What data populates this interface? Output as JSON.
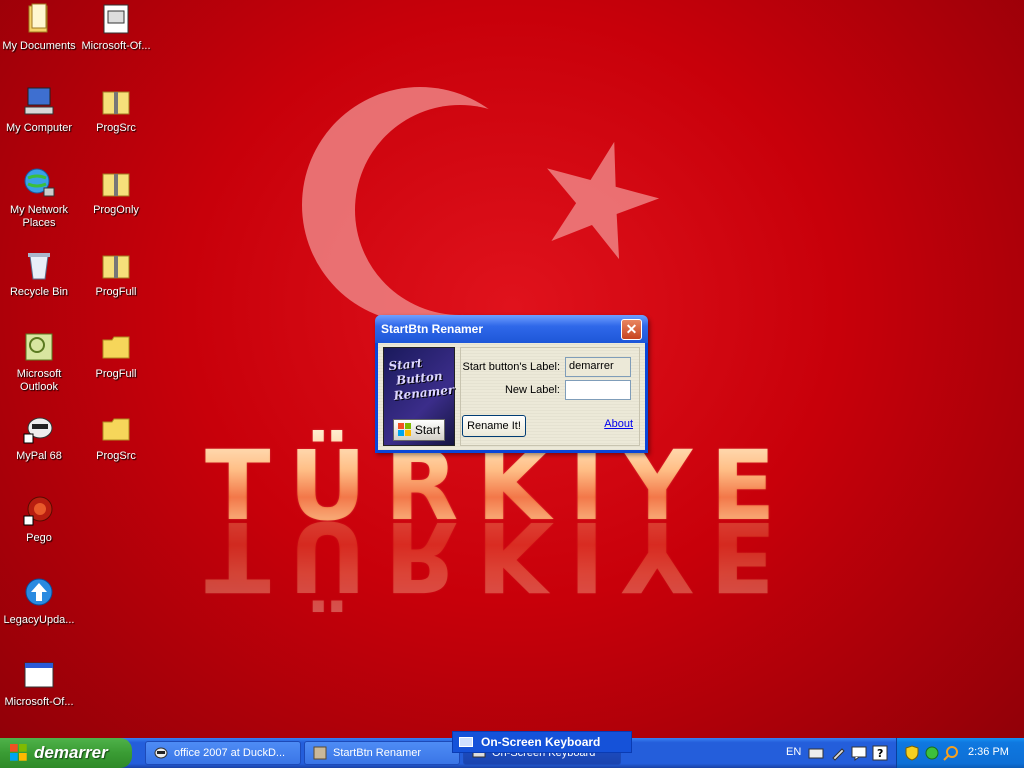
{
  "wallpaper": {
    "title": "TÜRKIYE"
  },
  "desktop": {
    "icons": [
      {
        "label": "My Documents"
      },
      {
        "label": "Microsoft-Of..."
      },
      {
        "label": "My Computer"
      },
      {
        "label": "ProgSrc"
      },
      {
        "label": "My Network Places"
      },
      {
        "label": "ProgOnly"
      },
      {
        "label": "Recycle Bin"
      },
      {
        "label": "ProgFull"
      },
      {
        "label": "Microsoft Outlook"
      },
      {
        "label": "ProgFull"
      },
      {
        "label": "MyPal 68"
      },
      {
        "label": "ProgSrc"
      },
      {
        "label": "Pego"
      },
      {
        "label": "LegacyUpda..."
      },
      {
        "label": "Microsoft-Of..."
      }
    ]
  },
  "dialog": {
    "title": "StartBtn Renamer",
    "close_glyph": "✕",
    "logo_lines": [
      "Start",
      "Button",
      "Renamer"
    ],
    "logo_start_label": "Start",
    "start_label_caption": "Start button's Label:",
    "start_label_value": "demarrer",
    "new_label_caption": "New Label:",
    "new_label_value": "",
    "rename_button": "Rename It!",
    "about_link": "About"
  },
  "taskbar": {
    "start_label": "demarrer",
    "tasks": [
      {
        "label": "office 2007 at DuckD..."
      },
      {
        "label": "StartBtn Renamer"
      },
      {
        "label": "On-Screen Keyboard"
      }
    ],
    "tooltip": "On-Screen Keyboard",
    "language": "EN",
    "clock": "2:36 PM"
  },
  "colors": {
    "wallpaper_red": "#c8000a",
    "taskbar_blue": "#245edb",
    "start_green": "#3a9c34"
  }
}
